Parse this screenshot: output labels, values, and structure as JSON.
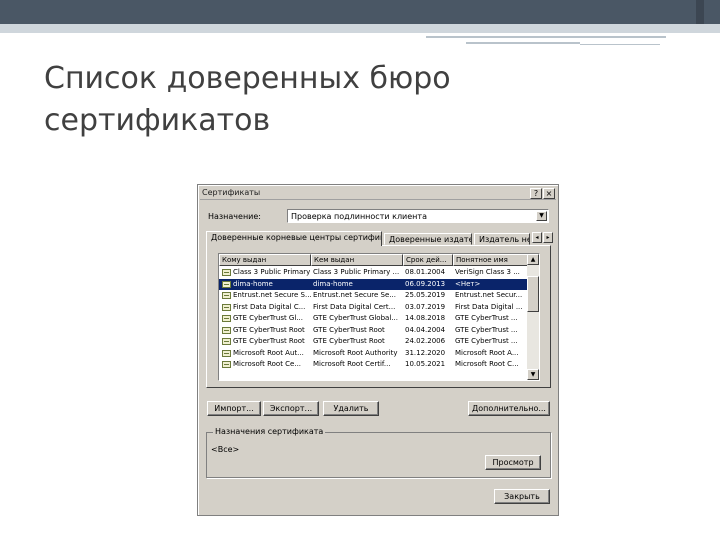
{
  "slide": {
    "title_line1": "Список доверенных бюро",
    "title_line2": "сертификатов",
    "colors": {
      "band_dark": "#4a5765",
      "band_light": "#cfd6dc",
      "title_text": "#404040"
    }
  },
  "dialog": {
    "title": "Сертификаты",
    "help_btn": "?",
    "close_btn": "×",
    "purpose_label": "Назначение:",
    "purpose_value": "Проверка подлинности клиента",
    "tabs": [
      {
        "label": "Доверенные корневые центры сертификации",
        "active": true
      },
      {
        "label": "Доверенные издатели",
        "active": false
      },
      {
        "label": "Издатель не",
        "active": false
      }
    ],
    "tab_scroll_left": "◂",
    "tab_scroll_right": "▸",
    "columns": [
      "Кому выдан",
      "Кем выдан",
      "Срок дей...",
      "Понятное имя"
    ],
    "rows": [
      [
        "Class 3 Public Primary ...",
        "Class 3 Public Primary ...",
        "08.01.2004",
        "VeriSign Class 3 ..."
      ],
      [
        "dima-home",
        "dima-home",
        "06.09.2013",
        "<Нет>"
      ],
      [
        "Entrust.net Secure S...",
        "Entrust.net Secure Se...",
        "25.05.2019",
        "Entrust.net Secur..."
      ],
      [
        "First Data Digital C...",
        "First Data Digital Cert...",
        "03.07.2019",
        "First Data Digital ..."
      ],
      [
        "GTE CyberTrust Gl...",
        "GTE CyberTrust Global...",
        "14.08.2018",
        "GTE CyberTrust ..."
      ],
      [
        "GTE CyberTrust Root",
        "GTE CyberTrust Root",
        "04.04.2004",
        "GTE CyberTrust ..."
      ],
      [
        "GTE CyberTrust Root",
        "GTE CyberTrust Root",
        "24.02.2006",
        "GTE CyberTrust ..."
      ],
      [
        "Microsoft Root Aut...",
        "Microsoft Root Authority",
        "31.12.2020",
        "Microsoft Root A..."
      ],
      [
        "Microsoft Root Ce...",
        "Microsoft Root Certif...",
        "10.05.2021",
        "Microsoft Root C..."
      ]
    ],
    "selected_row": 1,
    "scroll_up": "▲",
    "scroll_down": "▼",
    "buttons": {
      "import": "Импорт...",
      "export": "Экспорт...",
      "remove": "Удалить",
      "advanced": "Дополнительно...",
      "view": "Просмотр",
      "close": "Закрыть"
    },
    "purposes_group": {
      "label": "Назначения сертификата",
      "value": "<Все>"
    }
  }
}
